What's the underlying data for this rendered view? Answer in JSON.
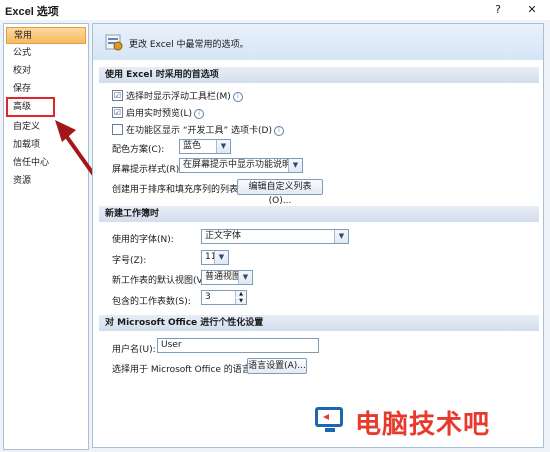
{
  "window": {
    "title": "Excel 选项",
    "help_label": "?",
    "close_label": "✕"
  },
  "sidebar": {
    "items": [
      {
        "label": "常用"
      },
      {
        "label": "公式"
      },
      {
        "label": "校对"
      },
      {
        "label": "保存"
      },
      {
        "label": "高级"
      },
      {
        "label": "自定义"
      },
      {
        "label": "加载项"
      },
      {
        "label": "信任中心"
      },
      {
        "label": "资源"
      }
    ],
    "selected": "常用",
    "highlighted": "高级"
  },
  "banner": {
    "text": "更改 Excel 中最常用的选项。"
  },
  "section1": {
    "header": "使用 Excel 时采用的首选项",
    "opt1": "选择时显示浮动工具栏(M)",
    "opt2": "启用实时预览(L)",
    "opt3": "在功能区显示 “开发工具” 选项卡(D)",
    "opt1_checked": "☑",
    "opt2_checked": "☑",
    "color_label": "配色方案(C):",
    "color_value": "蓝色",
    "tip_label": "屏幕提示样式(R):",
    "tip_value": "在屏幕提示中显示功能说明",
    "list_label": "创建用于排序和填充序列的列表:",
    "list_button": "编辑自定义列表(O)..."
  },
  "section2": {
    "header": "新建工作簿时",
    "font_label": "使用的字体(N):",
    "font_value": "正文字体",
    "size_label": "字号(Z):",
    "size_value": "11",
    "view_label": "新工作表的默认视图(V):",
    "view_value": "普通视图",
    "sheets_label": "包含的工作表数(S):",
    "sheets_value": "3"
  },
  "section3": {
    "header": "对 Microsoft Office 进行个性化设置",
    "user_label": "用户名(U):",
    "user_value": "User",
    "lang_label": "选择用于 Microsoft Office 的语言:",
    "lang_button": "语言设置(A)..."
  },
  "watermark": {
    "text": "电脑技术吧"
  },
  "colors": {
    "accent": "#e0262a",
    "selected_nav": "#f8b961",
    "header_bg": "#d3deec"
  }
}
